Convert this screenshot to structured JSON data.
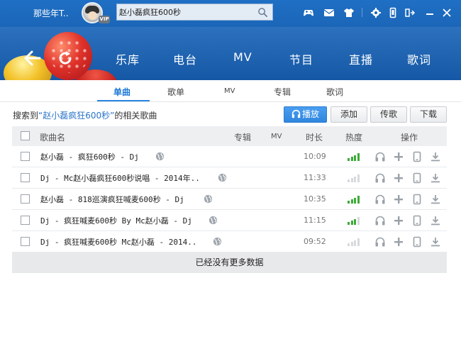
{
  "header": {
    "user_name": "那些年T..",
    "vip_label": "VIP",
    "search_value": "赵小磊疯狂600秒",
    "nav": [
      "乐库",
      "电台",
      "MV",
      "节目",
      "直播",
      "歌词"
    ],
    "tools": [
      "gamepad-icon",
      "mail-icon",
      "shirt-icon",
      "settings-icon",
      "mobile-icon",
      "mini-mode-icon",
      "minimize-icon",
      "close-icon"
    ]
  },
  "subtabs": [
    "单曲",
    "歌单",
    "MV",
    "专辑",
    "歌词"
  ],
  "active_subtab": "单曲",
  "result": {
    "prefix": "搜索到",
    "keyword": "“赵小磊疯狂600秒”",
    "suffix": "的相关歌曲"
  },
  "buttons": {
    "play": "播放",
    "add": "添加",
    "upload": "传歌",
    "download": "下载"
  },
  "table": {
    "columns": {
      "name": "歌曲名",
      "album": "专辑",
      "mv": "MV",
      "duration": "时长",
      "heat": "热度",
      "ops": "操作"
    },
    "rows": [
      {
        "title": "赵小磊 - 疯狂600秒 - Dj",
        "duration": "10:09",
        "heat": 4
      },
      {
        "title": "Dj - Mc赵小磊疯狂600秒说唱 - 2014年..",
        "duration": "11:33",
        "heat": 0
      },
      {
        "title": "赵小磊 - 818巡演疯狂喊麦600秒 - Dj",
        "duration": "10:35",
        "heat": 4
      },
      {
        "title": "Dj - 疯狂喊麦600秒 By Mc赵小磊 - Dj",
        "duration": "11:15",
        "heat": 3
      },
      {
        "title": "Dj - 疯狂喊麦600秒 Mc赵小磊 - 2014..",
        "duration": "09:52",
        "heat": 0
      }
    ],
    "no_more": "已经没有更多数据"
  },
  "colors": {
    "header_blue": "#1a64b6",
    "accent": "#1d78d6",
    "heat_on": "#3cab38"
  }
}
